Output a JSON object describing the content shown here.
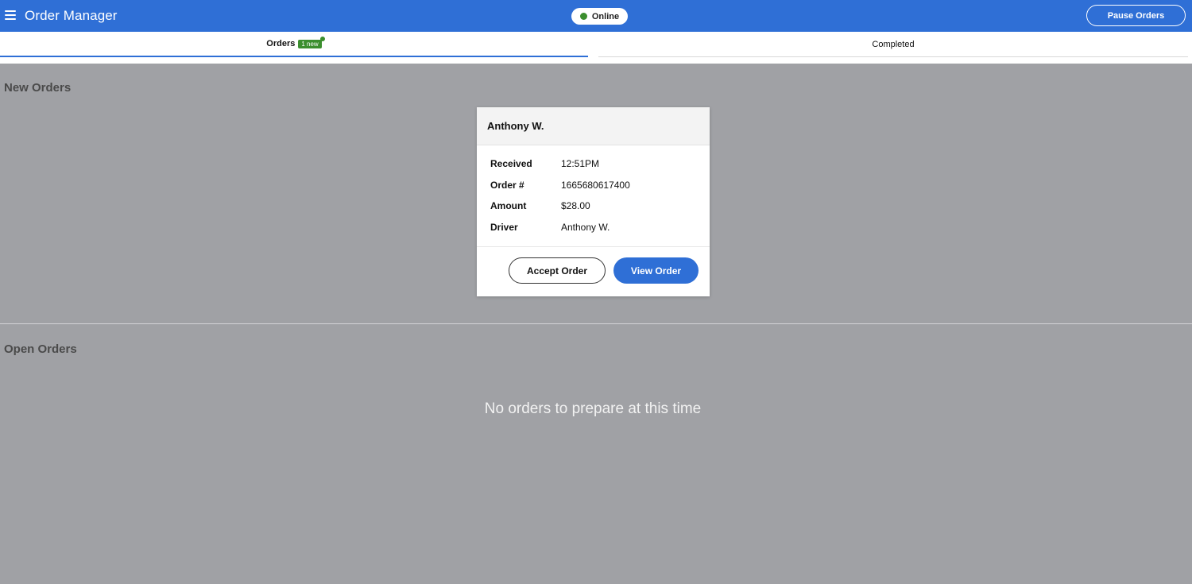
{
  "header": {
    "app_title": "Order Manager",
    "status": "Online",
    "status_color": "#3b8e2e",
    "pause_label": "Pause Orders",
    "menu_icon": "hamburger-menu-icon",
    "brand_color": "#2f6fd6"
  },
  "tabs": {
    "orders_label": "Orders",
    "orders_badge": "1 new",
    "completed_label": "Completed"
  },
  "sections": {
    "new_orders_title": "New Orders",
    "open_orders_title": "Open Orders",
    "open_orders_empty": "No orders to prepare at this time"
  },
  "order_card": {
    "customer": "Anthony W.",
    "fields": [
      {
        "label": "Received",
        "value": "12:51PM"
      },
      {
        "label": "Order #",
        "value": "1665680617400"
      },
      {
        "label": "Amount",
        "value": "$28.00"
      },
      {
        "label": "Driver",
        "value": "Anthony W."
      }
    ],
    "accept_label": "Accept Order",
    "view_label": "View Order"
  }
}
